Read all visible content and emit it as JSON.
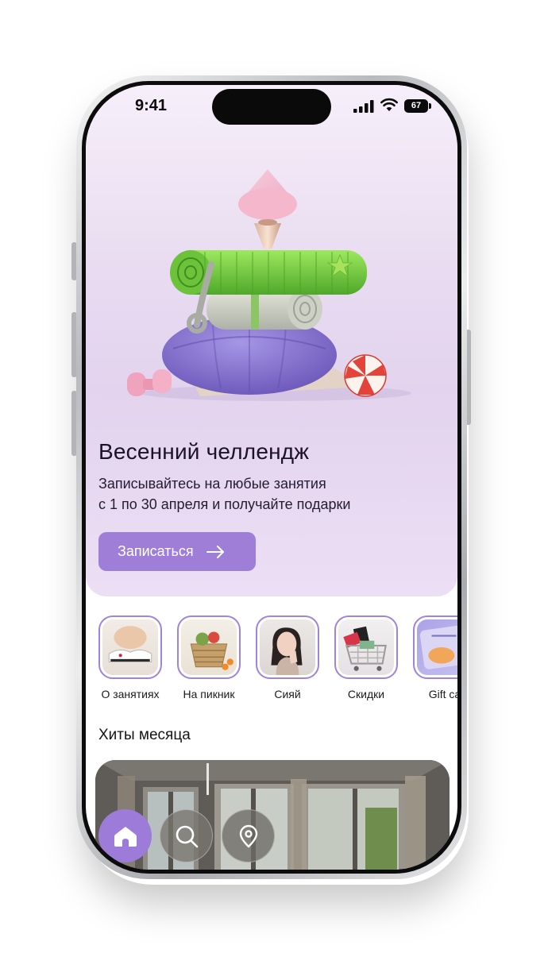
{
  "status_bar": {
    "time": "9:41",
    "battery": "67"
  },
  "hero": {
    "title": "Весенний челлендж",
    "subtitle_line1": "Записывайтесь на любые занятия",
    "subtitle_line2": "с 1 по 30 апреля и получайте подарки",
    "cta_label": "Записаться"
  },
  "categories": [
    {
      "label": "О занятиях"
    },
    {
      "label": "На пикник"
    },
    {
      "label": "Сияй"
    },
    {
      "label": "Скидки"
    },
    {
      "label": "Gift ca"
    }
  ],
  "section": {
    "title": "Хиты месяца"
  },
  "nav": {
    "items": [
      "home-icon",
      "search-icon",
      "location-pin-icon"
    ],
    "active": "home-icon"
  },
  "colors": {
    "accent": "#9f7ed8",
    "hero_bg": "#e7d9f0",
    "ring": "#a083dc"
  }
}
